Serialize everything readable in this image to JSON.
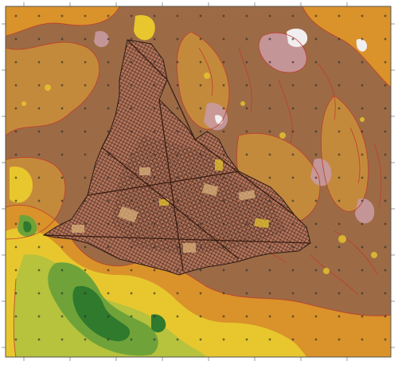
{
  "map": {
    "kind": "topographic elevation map with city street-grid overlay",
    "colors": {
      "frame": "#ffffff",
      "border": "#555555",
      "low_green_dark": "#2f7a2c",
      "low_green": "#6fa33a",
      "yellow_green": "#b7c23d",
      "yellow": "#e8c72e",
      "orange": "#d9932a",
      "tan": "#c48a3c",
      "brown": "#9c6b45",
      "high_pink": "#c99aa0",
      "peak_white": "#f1eef0",
      "contour_red": "#c0392b",
      "streets": "#2a1a14",
      "graticule_cross": "#2b2b2b"
    },
    "icons": [
      "graticule-cross-icon"
    ]
  }
}
